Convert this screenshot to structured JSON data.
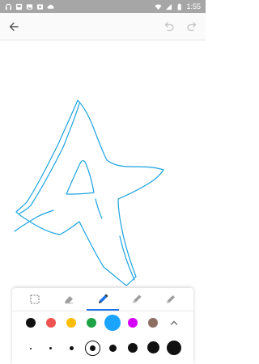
{
  "status_bar": {
    "time": "1:55",
    "left_icons": [
      "headphones-icon",
      "notification-icon",
      "image-icon",
      "photo-icon",
      "cloud-icon"
    ],
    "right_icons": [
      "wifi-icon",
      "signal-icon",
      "battery-icon"
    ]
  },
  "app_bar": {
    "back_icon": "back-arrow-icon",
    "undo_icon": "undo-icon",
    "redo_icon": "redo-icon"
  },
  "toolbar": {
    "tools": [
      {
        "name": "selection",
        "icon": "selection-icon",
        "active": false
      },
      {
        "name": "eraser",
        "icon": "eraser-icon",
        "active": false
      },
      {
        "name": "pen",
        "icon": "pen-icon",
        "active": true
      },
      {
        "name": "marker",
        "icon": "marker-icon",
        "active": false
      },
      {
        "name": "highlighter",
        "icon": "highlighter-icon",
        "active": false
      }
    ],
    "colors": [
      {
        "name": "black",
        "hex": "#111111"
      },
      {
        "name": "red",
        "hex": "#ef5350"
      },
      {
        "name": "yellow",
        "hex": "#fbbc04"
      },
      {
        "name": "green",
        "hex": "#1ea446"
      },
      {
        "name": "blue",
        "hex": "#1aa3ff",
        "selected": true
      },
      {
        "name": "purple",
        "hex": "#d500f9"
      },
      {
        "name": "brown",
        "hex": "#8d6e63"
      }
    ],
    "expand_icon": "chevron-up-icon",
    "sizes": [
      {
        "level": 1
      },
      {
        "level": 2
      },
      {
        "level": 3
      },
      {
        "level": 4,
        "selected": true
      },
      {
        "level": 5
      },
      {
        "level": 6
      },
      {
        "level": 7
      },
      {
        "level": 8
      }
    ]
  },
  "colors": {
    "status_bar": "#a6a6a6",
    "accent": "#1a73e8",
    "stroke": "#1aa3e0"
  }
}
